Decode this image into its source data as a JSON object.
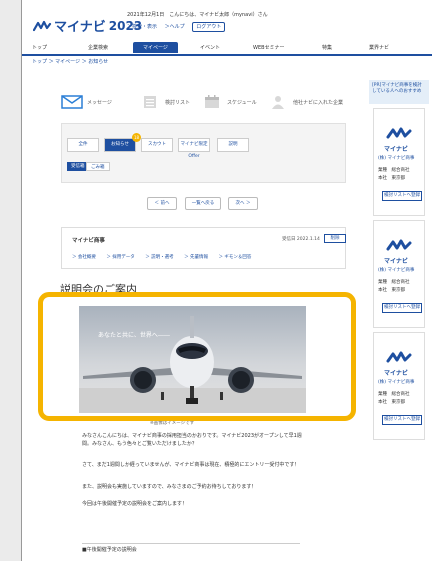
{
  "header": {
    "brand": "マイナビ",
    "year": "2023",
    "info": "2021年12月1日　こんにちは、マイナビ太郎（mynavi）さん",
    "links": [
      "＞検索・表示",
      "＞ヘルプ"
    ],
    "logout": "ログアウト"
  },
  "gnav": {
    "items": [
      "トップ",
      "企業検索",
      "マイページ",
      "イベント",
      "WEBセミナー",
      "特集",
      "業界ナビ"
    ],
    "active_index": 2
  },
  "breadcrumb": "トップ ＞ マイページ ＞ お知らせ",
  "tabs": {
    "items": [
      "メッセージ",
      "検討リスト",
      "スケジュール",
      "他社ナビに入れた企業"
    ]
  },
  "subtabs": {
    "items": [
      "全件",
      "お知らせ",
      "スカウト",
      "マイナビ限定Offer",
      "説明"
    ],
    "active_index": 1,
    "badge": "18"
  },
  "filters": [
    "受信箱",
    "ごみ箱"
  ],
  "pager": {
    "prev": "＜ 前へ",
    "list": "一覧へ戻る",
    "next": "次へ ＞"
  },
  "message": {
    "from": "マイナビ商事",
    "date": "受信日 2022.1.14",
    "delete": "削除",
    "links": [
      "＞ 会社概要",
      "＞ 採用データ",
      "＞ 説明・選考",
      "＞ 先輩情報",
      "＞ ギモン＆回答"
    ]
  },
  "article": {
    "title": "説明会のご案内",
    "photo_caption": "あなたと共に、世界へ――",
    "image_note": "※画像はイメージです",
    "paragraphs": [
      "みなさんこんにちは、マイナビ商事の採用担当のかおりです。マイナビ2023がオープンして早1週間。みなさん、もう色々とご覧いただけましたか？",
      "さて、まだ1週間しか経っていませんが、マイナビ商事は現在、積極的にエントリー受付中です！",
      "また、説明会も実施していますので、みなさまのご予約お待ちしております！",
      "今回は午後開催予定の説明会をご案内します！",
      "■午後開催予定の説明会"
    ]
  },
  "sidebar": {
    "header": "[PR]マイナビ商事を検討している人へのおすすめ",
    "cards": [
      {
        "logo": "マイナビ",
        "name": "(株) マイナビ商事",
        "industry": "業種　総合商社",
        "location": "本社　東京都",
        "button": "検討リストへ登録"
      },
      {
        "logo": "マイナビ",
        "name": "(株) マイナビ商事",
        "industry": "業種　総合商社",
        "location": "本社　東京都",
        "button": "検討リストへ登録"
      },
      {
        "logo": "マイナビ",
        "name": "(株) マイナビ商事",
        "industry": "業種　総合商社",
        "location": "本社　東京都",
        "button": "検討リストへ登録"
      }
    ]
  },
  "colors": {
    "brand": "#1e4fa0",
    "highlight": "#f5b400"
  }
}
